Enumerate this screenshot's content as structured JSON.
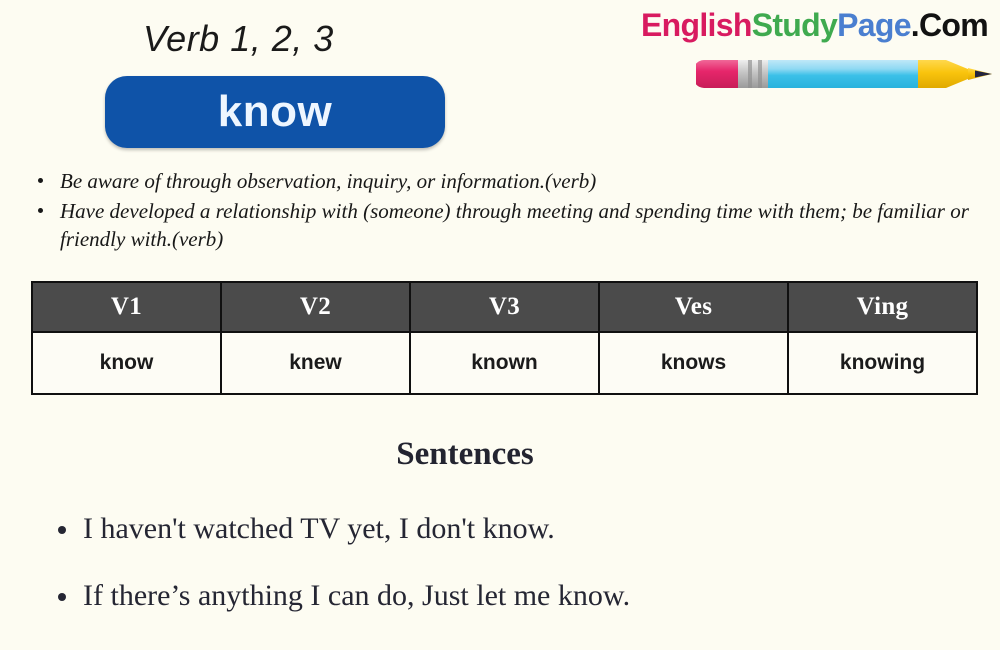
{
  "header": {
    "title": "Verb 1, 2, 3",
    "verb": "know",
    "pill_color": "#0f53a8"
  },
  "logo": {
    "part1": "English",
    "part2": "Study",
    "part3": "Page",
    "part4": ".Com",
    "color1": "#d81b60",
    "color2": "#3faa4f",
    "color3": "#4a7fd0",
    "color4": "#121212",
    "icon": "pencil-icon",
    "pencil": {
      "eraser_color": "#e6266b",
      "ferrule_color": "#b9b9b9",
      "body_color": "#3bc0e8",
      "body_highlight": "#a8e0f5",
      "tip_color": "#f6c211",
      "point_color": "#23243f"
    }
  },
  "definitions": [
    "Be aware of through observation, inquiry, or information.(verb)",
    "Have developed a relationship with (someone) through meeting and spending time with them; be familiar or friendly with.(verb)"
  ],
  "table": {
    "headers": [
      "V1",
      "V2",
      "V3",
      "Ves",
      "Ving"
    ],
    "row": [
      "know",
      "knew",
      "known",
      "knows",
      "knowing"
    ],
    "header_bg": "#4b4b4b",
    "cell_bg": "#fdfcf5"
  },
  "sentences": {
    "heading": "Sentences",
    "items": [
      "I haven't watched TV yet, I don't know.",
      "If there’s anything I can do, Just let me know."
    ]
  },
  "page": {
    "background": "#fdfcf2"
  }
}
